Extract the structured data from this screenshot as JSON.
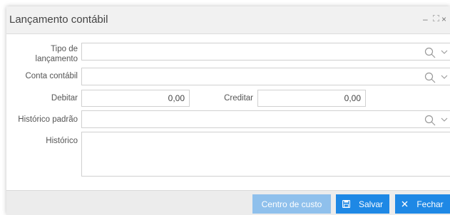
{
  "dialog": {
    "title": "Lançamento contábil",
    "controls": {
      "minimize": "–",
      "maximize": "⛶",
      "close": "×"
    }
  },
  "form": {
    "tipo_label_1": "Tipo de",
    "tipo_label_2": "lançamento",
    "tipo_value": "",
    "conta_label": "Conta contábil",
    "conta_value": "",
    "debitar_label": "Debitar",
    "debitar_value": "0,00",
    "creditar_label": "Creditar",
    "creditar_value": "0,00",
    "historico_padrao_label": "Histórico padrão",
    "historico_padrao_value": "",
    "historico_label": "Histórico",
    "historico_value": ""
  },
  "footer": {
    "centro_label": "Centro de custo",
    "salvar_label": "Salvar",
    "fechar_label": "Fechar"
  },
  "colors": {
    "primary": "#1e88e5",
    "primary_disabled": "#8fc0ec",
    "titlebar_bg": "#f1f1f1",
    "footer_bg": "#ececec"
  },
  "icons": [
    "search-icon",
    "chevron-down-icon",
    "save-icon",
    "close-icon"
  ]
}
